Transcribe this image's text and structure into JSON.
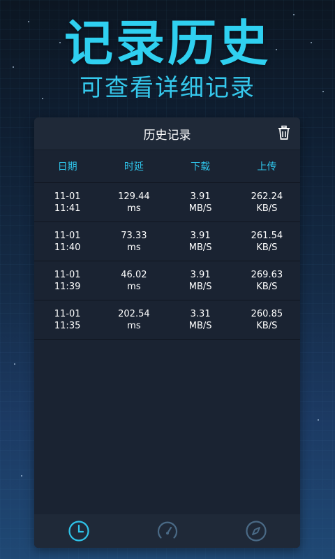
{
  "headline": "记录历史",
  "subtitle": "可查看详细记录",
  "panel": {
    "title": "历史记录",
    "trash_icon": "trash-icon"
  },
  "table": {
    "headers": [
      "日期",
      "时延",
      "下载",
      "上传"
    ],
    "rows": [
      {
        "date": "11-01",
        "time": "11:41",
        "latency": "129.44",
        "latency_unit": "ms",
        "download": "3.91",
        "download_unit": "MB/S",
        "upload": "262.24",
        "upload_unit": "KB/S"
      },
      {
        "date": "11-01",
        "time": "11:40",
        "latency": "73.33",
        "latency_unit": "ms",
        "download": "3.91",
        "download_unit": "MB/S",
        "upload": "261.54",
        "upload_unit": "KB/S"
      },
      {
        "date": "11-01",
        "time": "11:39",
        "latency": "46.02",
        "latency_unit": "ms",
        "download": "3.91",
        "download_unit": "MB/S",
        "upload": "269.63",
        "upload_unit": "KB/S"
      },
      {
        "date": "11-01",
        "time": "11:35",
        "latency": "202.54",
        "latency_unit": "ms",
        "download": "3.31",
        "download_unit": "MB/S",
        "upload": "260.85",
        "upload_unit": "KB/S"
      }
    ]
  },
  "nav": {
    "items": [
      "clock-icon",
      "speedometer-icon",
      "compass-icon"
    ],
    "active_color": "#2fc4ea",
    "inactive_color": "#4a6a86"
  },
  "colors": {
    "accent": "#2fd0f0",
    "panel_bg": "#1a2332"
  }
}
